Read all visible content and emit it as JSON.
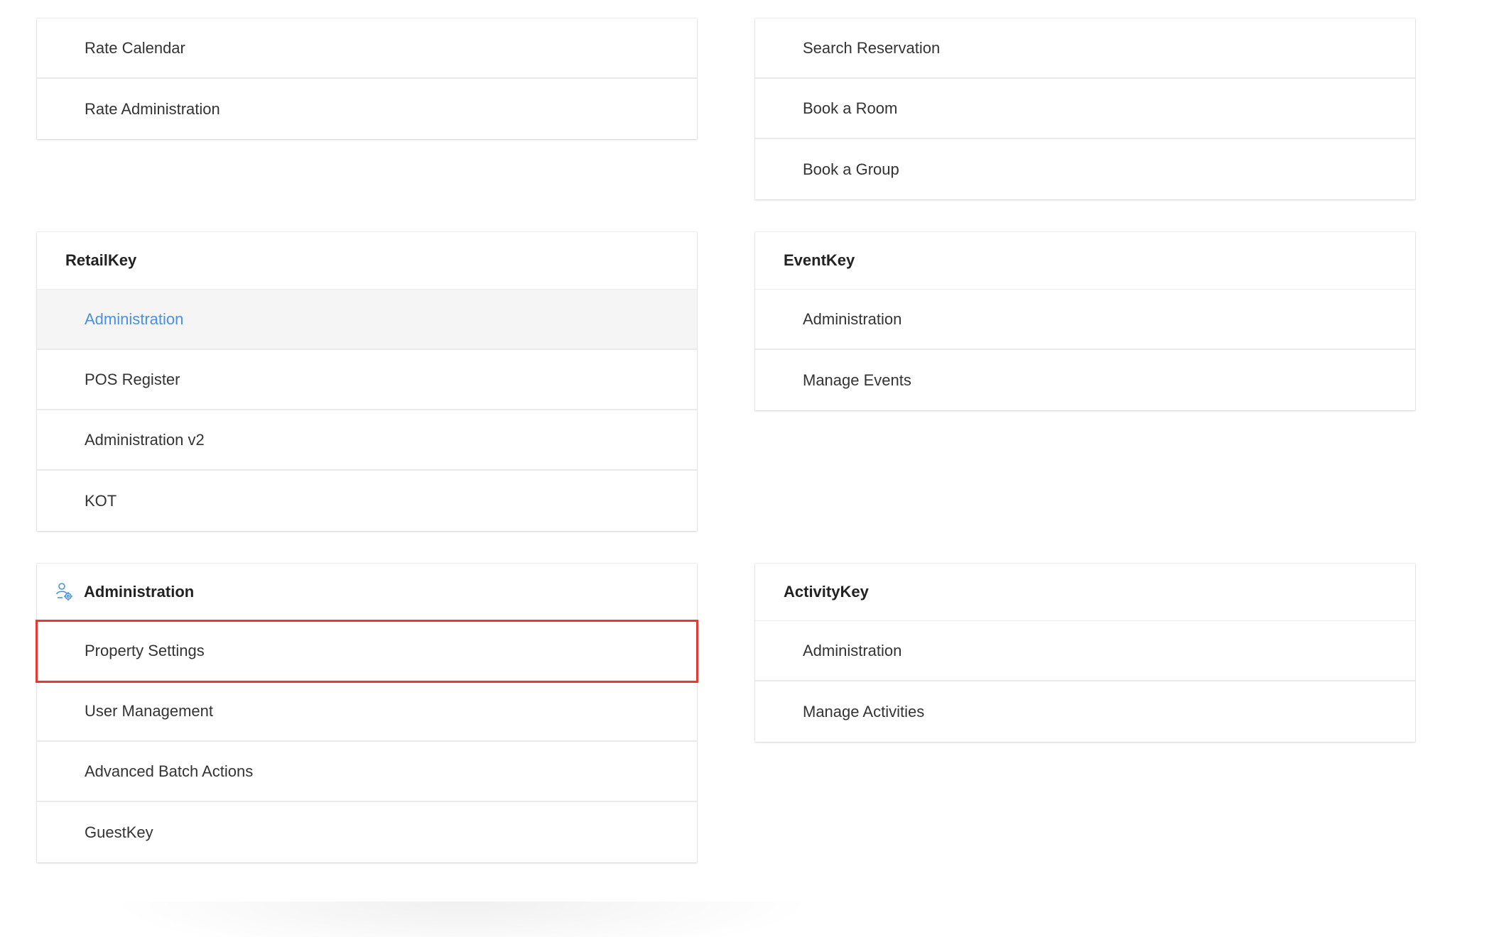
{
  "top_left_card": {
    "items": [
      "Rate Calendar",
      "Rate Administration"
    ]
  },
  "top_right_card": {
    "items": [
      "Search Reservation",
      "Book a Room",
      "Book a Group"
    ]
  },
  "retailkey_card": {
    "title": "RetailKey",
    "items": [
      "Administration",
      "POS Register",
      "Administration v2",
      "KOT"
    ],
    "active_item": "Administration"
  },
  "eventkey_card": {
    "title": "EventKey",
    "items": [
      "Administration",
      "Manage Events"
    ]
  },
  "administration_card": {
    "title": "Administration",
    "icon": "admin-users-icon",
    "items": [
      "Property Settings",
      "User Management",
      "Advanced Batch Actions",
      "GuestKey"
    ],
    "highlighted_item": "Property Settings"
  },
  "activitykey_card": {
    "title": "ActivityKey",
    "items": [
      "Administration",
      "Manage Activities"
    ]
  },
  "colors": {
    "active_link": "#4a90e2",
    "highlight_outline": "#e53935",
    "icon": "#4a90e2"
  }
}
